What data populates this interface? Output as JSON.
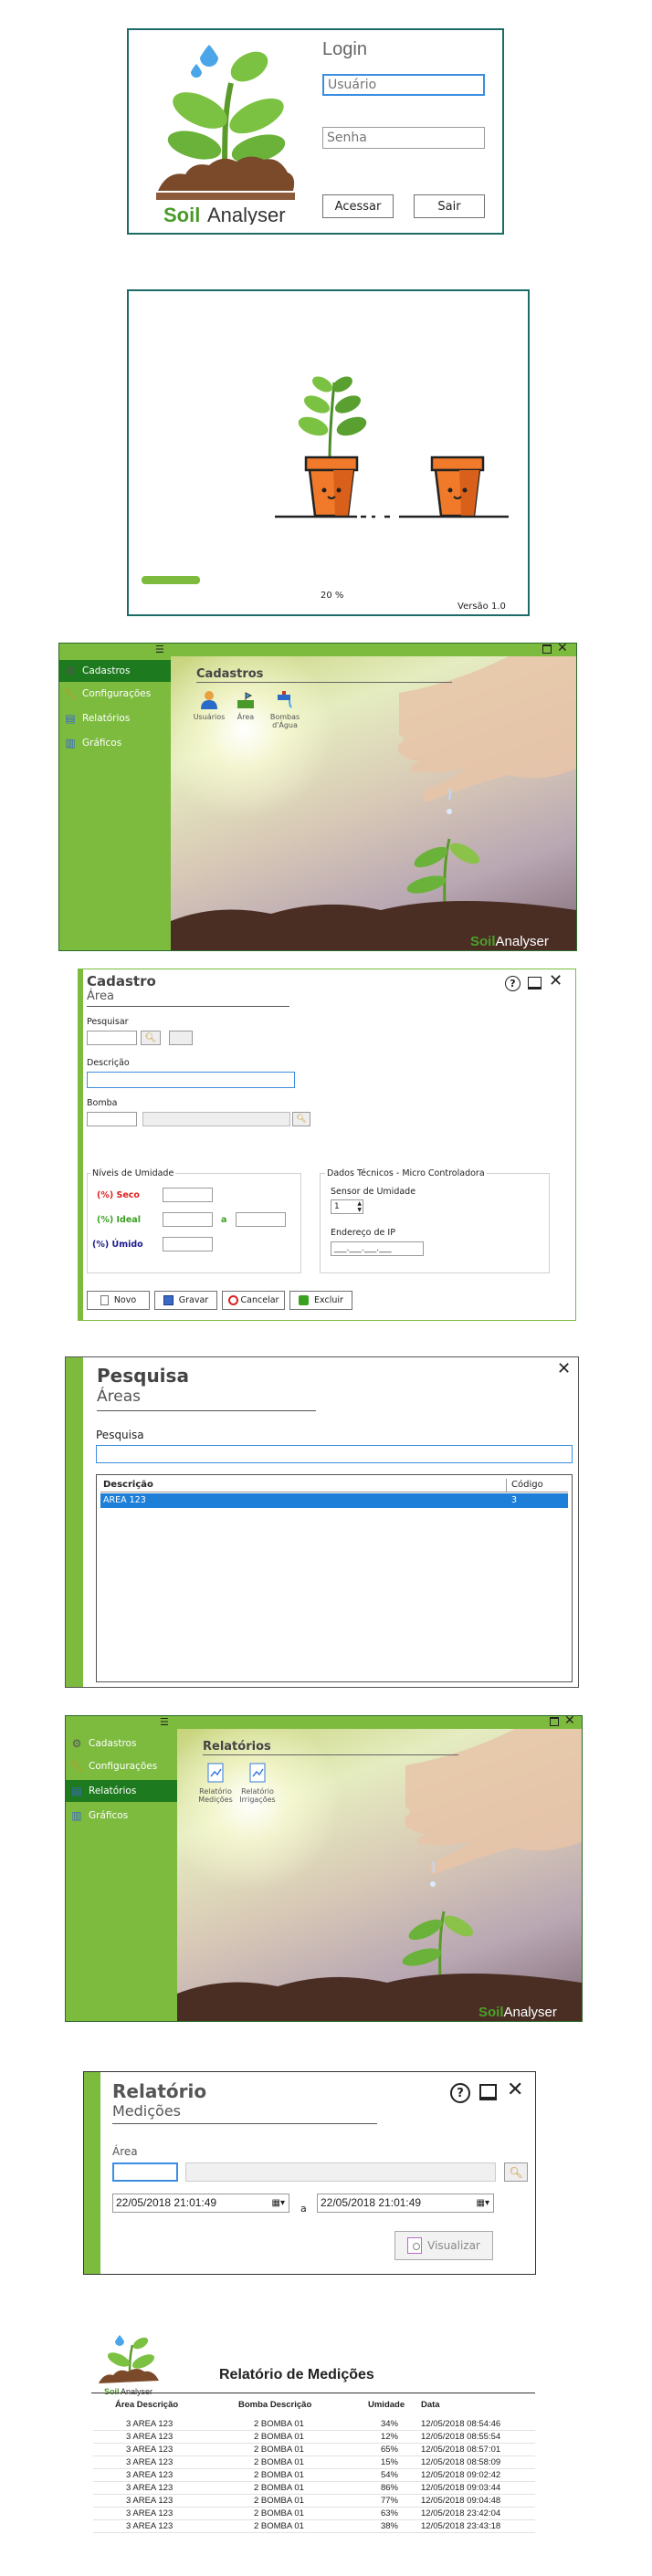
{
  "login": {
    "title": "Login",
    "user_placeholder": "Usuário",
    "password_placeholder": "Senha",
    "enter_label": "Acessar",
    "exit_label": "Sair",
    "logo_soil": "Soil",
    "logo_analyser": "Analyser"
  },
  "splash": {
    "progress_text": "20 %",
    "progress_fraction": 0.2,
    "version": "Versão 1.0"
  },
  "main1": {
    "menu_items": [
      "Cadastros",
      "Configurações",
      "Relatórios",
      "Gráficos"
    ],
    "active_index": 0,
    "section_title": "Cadastros",
    "tiles": [
      "Usuários",
      "Área",
      "Bombas d'Água"
    ],
    "brand_soil": "Soil",
    "brand_analyser": "Analyser"
  },
  "cadastro": {
    "title": "Cadastro",
    "subtitle": "Área",
    "search_label": "Pesquisar",
    "desc_label": "Descrição",
    "pump_label": "Bomba",
    "humidity_group": "Níveis de Umidade",
    "dry_label": "(%) Seco",
    "ideal_label": "(%) Ideal",
    "a_label": "a",
    "wet_label": "(%) Úmido",
    "tech_group": "Dados Técnicos - Micro Controladora",
    "sensor_label": "Sensor de Umidade",
    "sensor_value": "1",
    "ip_label": "Endereço de IP",
    "ip_mask": "___.___.___.___",
    "buttons": [
      "Novo",
      "Gravar",
      "Cancelar",
      "Excluir"
    ],
    "help_icon": "?",
    "colors": {
      "dry": "#e02020",
      "ideal": "#3aa020",
      "wet": "#1a1a8c"
    }
  },
  "pesquisa": {
    "title": "Pesquisa",
    "subtitle": "Áreas",
    "search_label": "Pesquisa",
    "col_desc": "Descrição",
    "col_code": "Código",
    "row_desc": "AREA 123",
    "row_code": "3"
  },
  "main2": {
    "menu_items": [
      "Cadastros",
      "Configurações",
      "Relatórios",
      "Gráficos"
    ],
    "active_index": 2,
    "section_title": "Relatórios",
    "tiles": [
      "Relatório Medições",
      "Relatório Irrigações"
    ],
    "brand_soil": "Soil",
    "brand_analyser": "Analyser"
  },
  "relatorio": {
    "title": "Relatório",
    "subtitle": "Medições",
    "area_label": "Área",
    "date_from": "22/05/2018 21:01:49",
    "date_to": "22/05/2018 21:01:49",
    "a_label": "a",
    "view_label": "Visualizar"
  },
  "report": {
    "logo_soil": "Soil",
    "logo_analyser": "Analyser",
    "title": "Relatório de Medições",
    "headers": [
      "Área Descrição",
      "Bomba Descrição",
      "Umidade",
      "Data"
    ],
    "rows": [
      [
        "3 AREA 123",
        "2 BOMBA 01",
        "34%",
        "12/05/2018 08:54:46"
      ],
      [
        "3 AREA 123",
        "2 BOMBA 01",
        "12%",
        "12/05/2018 08:55:54"
      ],
      [
        "3 AREA 123",
        "2 BOMBA 01",
        "65%",
        "12/05/2018 08:57:01"
      ],
      [
        "3 AREA 123",
        "2 BOMBA 01",
        "15%",
        "12/05/2018 08:58:09"
      ],
      [
        "3 AREA 123",
        "2 BOMBA 01",
        "54%",
        "12/05/2018 09:02:42"
      ],
      [
        "3 AREA 123",
        "2 BOMBA 01",
        "86%",
        "12/05/2018 09:03:44"
      ],
      [
        "3 AREA 123",
        "2 BOMBA 01",
        "77%",
        "12/05/2018 09:04:48"
      ],
      [
        "3 AREA 123",
        "2 BOMBA 01",
        "63%",
        "12/05/2018 23:42:04"
      ],
      [
        "3 AREA 123",
        "2 BOMBA 01",
        "38%",
        "12/05/2018 23:43:18"
      ]
    ]
  }
}
